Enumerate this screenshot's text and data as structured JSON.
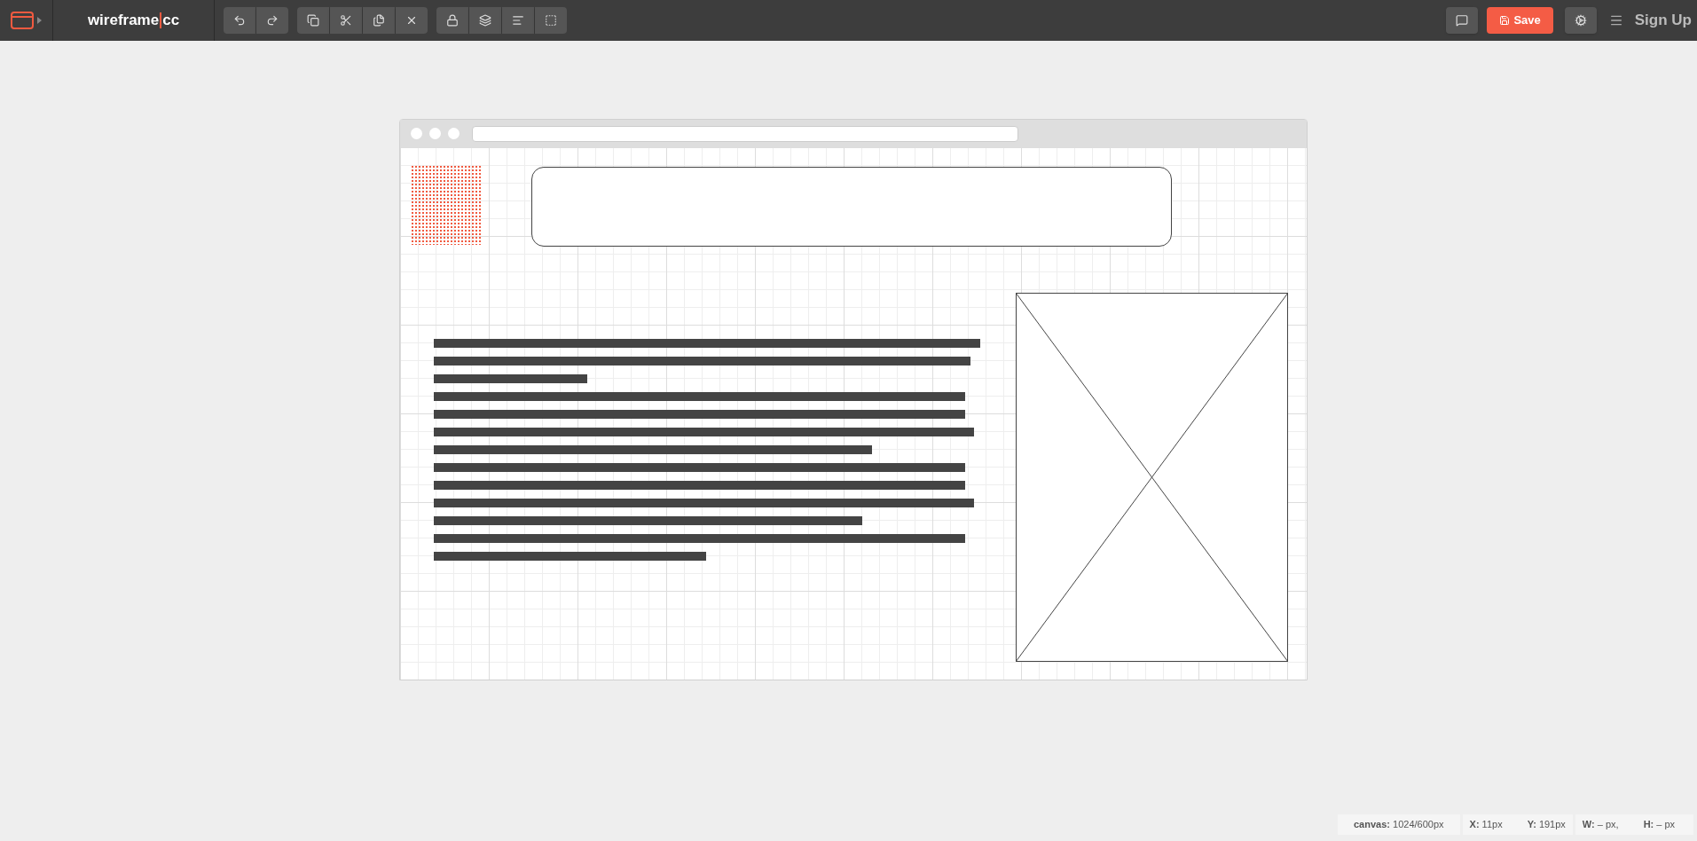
{
  "app": {
    "name_left": "wireframe",
    "name_right": "cc"
  },
  "toolbar_right": {
    "save": "Save",
    "sign_up": "Sign Up"
  },
  "status_bar": [
    "**canvas:** 1024/600px",
    "**X:** 11px",
    "**Y:** 191px",
    "**W:** – px,",
    "**H:** – px"
  ]
}
